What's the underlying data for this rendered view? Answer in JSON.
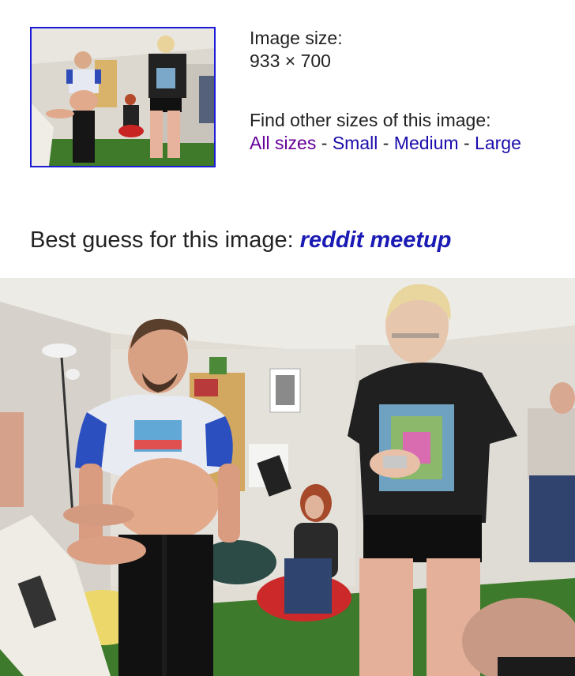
{
  "thumbnail": {
    "alt": "reddit meetup thumbnail"
  },
  "image_size": {
    "label": "Image size:",
    "value": "933 × 700"
  },
  "other_sizes": {
    "label": "Find other sizes of this image:",
    "links": [
      {
        "label": "All sizes",
        "visited": true
      },
      {
        "label": "Small",
        "visited": false
      },
      {
        "label": "Medium",
        "visited": false
      },
      {
        "label": "Large",
        "visited": false
      }
    ],
    "separator": " - "
  },
  "best_guess": {
    "prefix": "Best guess for this image: ",
    "query": "reddit meetup"
  },
  "colors": {
    "thumb_border": "#1a1ad8",
    "visited_link": "#660099",
    "link": "#1a0dab",
    "best_guess_link": "#1a1ab4"
  }
}
